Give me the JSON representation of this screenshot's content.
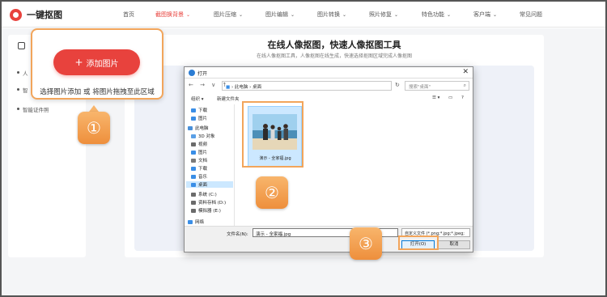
{
  "nav": {
    "logo_text": "一键抠图",
    "items": [
      {
        "label": "首页",
        "dropdown": false
      },
      {
        "label": "截图换背景",
        "dropdown": true,
        "active": true
      },
      {
        "label": "图片压缩",
        "dropdown": true
      },
      {
        "label": "图片编辑",
        "dropdown": true
      },
      {
        "label": "图片转换",
        "dropdown": true
      },
      {
        "label": "照片修复",
        "dropdown": true
      },
      {
        "label": "特色功能",
        "dropdown": true
      },
      {
        "label": "客户端",
        "dropdown": true
      },
      {
        "label": "常见问题",
        "dropdown": false
      }
    ]
  },
  "sidebar": {
    "items": [
      "人",
      "智",
      "智能证件照"
    ]
  },
  "main": {
    "title": "在线人像抠图，快速人像抠图工具",
    "subtitle": "在线人像抠图工具，人像抠图在线生成，快速选择抠图区域完成人像抠图"
  },
  "upload": {
    "button_label": "添加图片",
    "hint": "选择图片添加 或 将图片拖拽至此区域"
  },
  "badges": [
    "①",
    "②",
    "③"
  ],
  "dialog": {
    "title": "打开",
    "path": [
      "此电脑",
      "桌面"
    ],
    "search_placeholder": "搜索\"桌面\"",
    "organize": "组织 ▾",
    "new_folder": "新建文件夹",
    "tree": [
      {
        "label": "下载",
        "color": "#3a8ee6"
      },
      {
        "label": "图片",
        "color": "#3a8ee6"
      },
      {
        "label": "此电脑",
        "color": "#4a90d9"
      },
      {
        "label": "3D 对象",
        "color": "#5aa0e6"
      },
      {
        "label": "视频",
        "color": "#6b6b6b"
      },
      {
        "label": "图片",
        "color": "#3a8ee6"
      },
      {
        "label": "文档",
        "color": "#7a7a7a"
      },
      {
        "label": "下载",
        "color": "#3a8ee6"
      },
      {
        "label": "音乐",
        "color": "#3a8ee6"
      },
      {
        "label": "桌面",
        "color": "#3a8ee6",
        "selected": true
      },
      {
        "label": "系统 (C:)",
        "color": "#6b6b6b"
      },
      {
        "label": "资料存档 (D:)",
        "color": "#6b6b6b"
      },
      {
        "label": "模拟器 (E:)",
        "color": "#6b6b6b"
      },
      {
        "label": "网络",
        "color": "#3a8ee6"
      }
    ],
    "file": {
      "name": "演示 - 全家福.jpg"
    },
    "filename_label": "文件名(N):",
    "filename_value": "演示 - 全家福.jpg",
    "filetype": "自定义文件 (*.png;*.jpg;*.jpeg;",
    "open_label": "打开(O)",
    "cancel_label": "取消"
  },
  "colors": {
    "brand": "#e8423d",
    "highlight": "#f2a55b"
  }
}
